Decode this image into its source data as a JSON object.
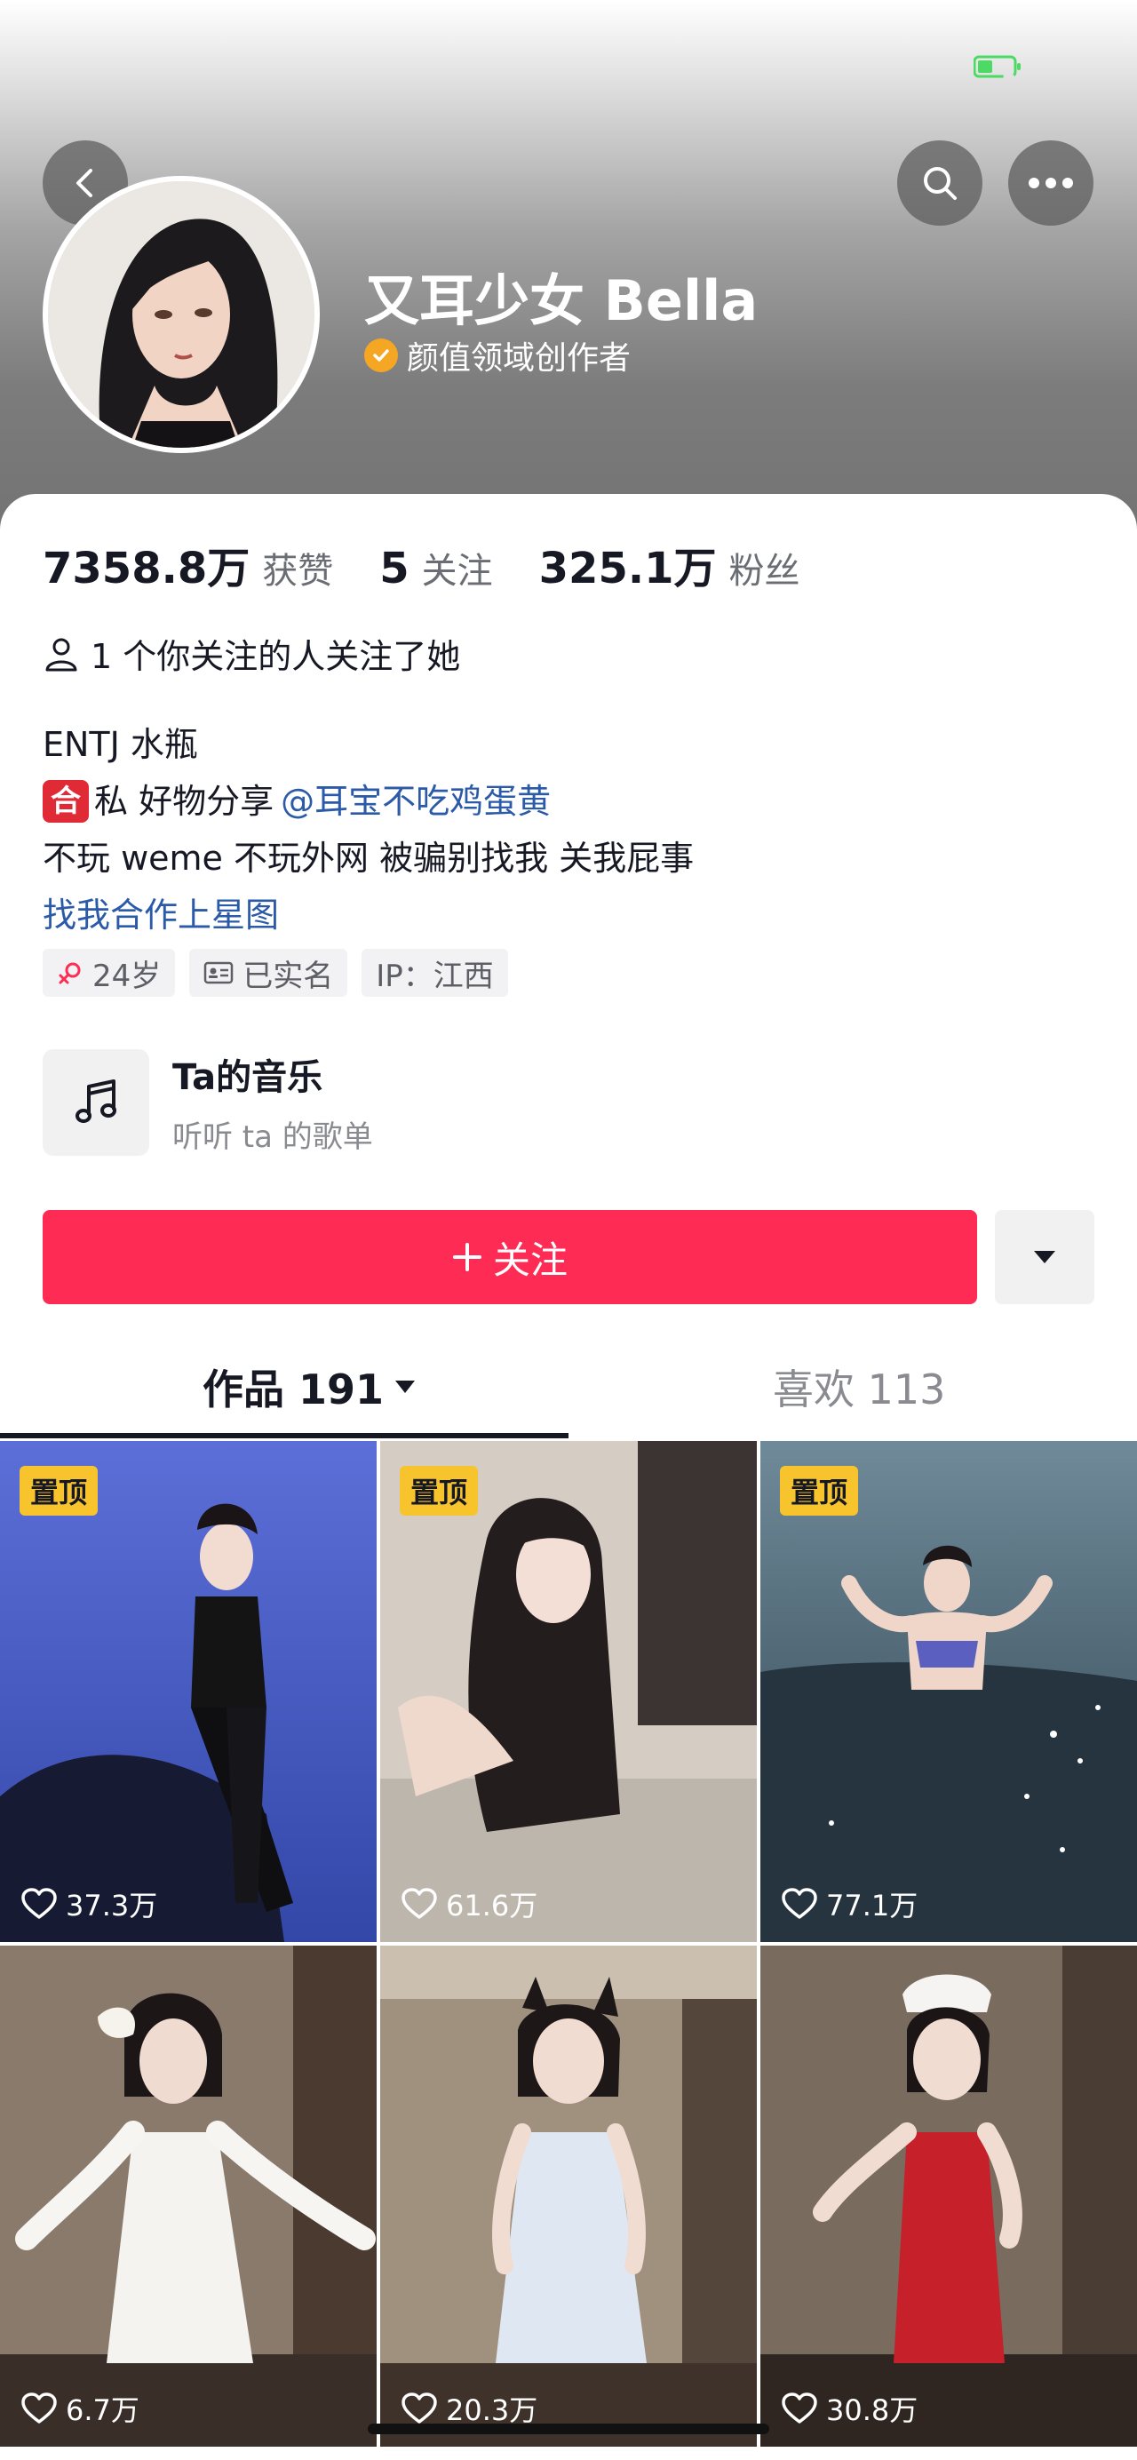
{
  "profile": {
    "name": "又耳少女 Bella",
    "verification": "颜值领域创作者"
  },
  "stats": {
    "likes_value": "7358.8万",
    "likes_label": "获赞",
    "following_value": "5",
    "following_label": "关注",
    "followers_value": "325.1万",
    "followers_label": "粉丝"
  },
  "mutual": "1 个你关注的人关注了她",
  "bio": {
    "line1": "ENTJ 水瓶",
    "line2_badge": "合",
    "line2_text": "私 好物分享",
    "line2_mention": "@耳宝不吃鸡蛋黄",
    "line3": "不玩 weme 不玩外网 被骗别找我 关我屁事",
    "line4_link": "找我合作上星图"
  },
  "tags": {
    "age": "24岁",
    "realname": "已实名",
    "ip": "IP：江西"
  },
  "music": {
    "title": "Ta的音乐",
    "subtitle": "听听 ta 的歌单"
  },
  "actions": {
    "follow_label": "关注"
  },
  "tabs": {
    "works": "作品 191",
    "likes": "喜欢 113"
  },
  "videos": [
    {
      "pinned": "置顶",
      "likes": "37.3万"
    },
    {
      "pinned": "置顶",
      "likes": "61.6万"
    },
    {
      "pinned": "置顶",
      "likes": "77.1万"
    },
    {
      "pinned": "",
      "likes": "6.7万"
    },
    {
      "pinned": "",
      "likes": "20.3万"
    },
    {
      "pinned": "",
      "likes": "30.8万"
    }
  ],
  "colors": {
    "accent": "#fe2c55",
    "link": "#2b5aa8",
    "pin": "#f8c42d",
    "verify": "#f5a623"
  }
}
